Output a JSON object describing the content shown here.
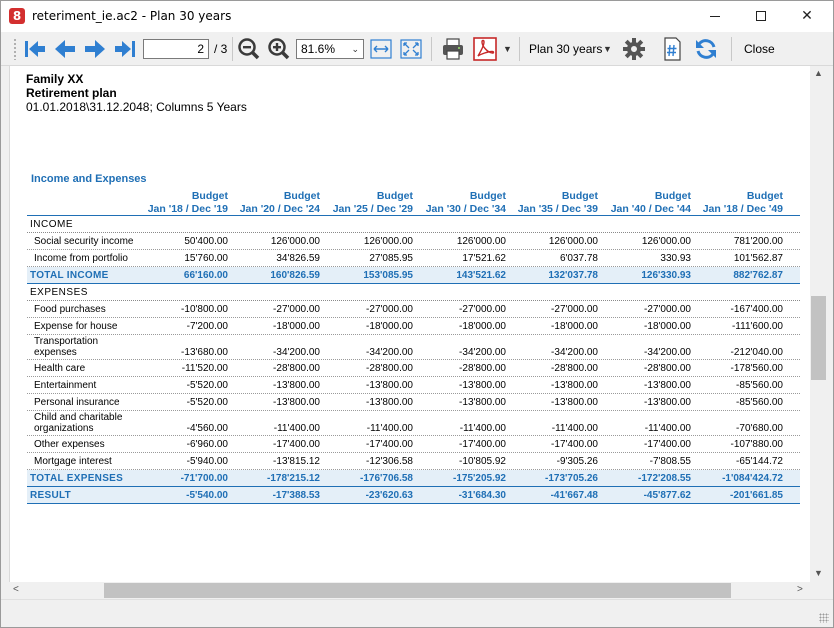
{
  "window": {
    "title": "reteriment_ie.ac2 - Plan 30 years"
  },
  "toolbar": {
    "page_value": "2",
    "page_total": "/ 3",
    "zoom": "81.6%",
    "plan": "Plan 30 years",
    "close_label": "Close"
  },
  "doc": {
    "line1": "Family XX",
    "line2": "Retirement plan",
    "line3": "01.01.2018\\31.12.2048; Columns 5 Years",
    "section": "Income and Expenses"
  },
  "columns": [
    {
      "top": "Budget",
      "bottom": "Jan '18 / Dec '19"
    },
    {
      "top": "Budget",
      "bottom": "Jan '20 / Dec '24"
    },
    {
      "top": "Budget",
      "bottom": "Jan '25 / Dec '29"
    },
    {
      "top": "Budget",
      "bottom": "Jan '30 / Dec '34"
    },
    {
      "top": "Budget",
      "bottom": "Jan '35 / Dec '39"
    },
    {
      "top": "Budget",
      "bottom": "Jan '40 / Dec '44"
    },
    {
      "top": "Budget",
      "bottom": "Jan '18 / Dec '49"
    }
  ],
  "rows": [
    {
      "kind": "sect",
      "label": "INCOME",
      "values": []
    },
    {
      "kind": "item",
      "label": "Social security income",
      "values": [
        "50'400.00",
        "126'000.00",
        "126'000.00",
        "126'000.00",
        "126'000.00",
        "126'000.00",
        "781'200.00"
      ]
    },
    {
      "kind": "item",
      "label": "Income from portfolio",
      "values": [
        "15'760.00",
        "34'826.59",
        "27'085.95",
        "17'521.62",
        "6'037.78",
        "330.93",
        "101'562.87"
      ]
    },
    {
      "kind": "total",
      "label": "TOTAL INCOME",
      "values": [
        "66'160.00",
        "160'826.59",
        "153'085.95",
        "143'521.62",
        "132'037.78",
        "126'330.93",
        "882'762.87"
      ]
    },
    {
      "kind": "sect",
      "label": "EXPENSES",
      "values": []
    },
    {
      "kind": "item",
      "label": "Food purchases",
      "values": [
        "-10'800.00",
        "-27'000.00",
        "-27'000.00",
        "-27'000.00",
        "-27'000.00",
        "-27'000.00",
        "-167'400.00"
      ]
    },
    {
      "kind": "item",
      "label": "Expense for house",
      "values": [
        "-7'200.00",
        "-18'000.00",
        "-18'000.00",
        "-18'000.00",
        "-18'000.00",
        "-18'000.00",
        "-111'600.00"
      ]
    },
    {
      "kind": "item2",
      "label": "Transportation",
      "label2": "expenses",
      "values": [
        "-13'680.00",
        "-34'200.00",
        "-34'200.00",
        "-34'200.00",
        "-34'200.00",
        "-34'200.00",
        "-212'040.00"
      ]
    },
    {
      "kind": "item",
      "label": "Health care",
      "values": [
        "-11'520.00",
        "-28'800.00",
        "-28'800.00",
        "-28'800.00",
        "-28'800.00",
        "-28'800.00",
        "-178'560.00"
      ]
    },
    {
      "kind": "item",
      "label": "Entertainment",
      "values": [
        "-5'520.00",
        "-13'800.00",
        "-13'800.00",
        "-13'800.00",
        "-13'800.00",
        "-13'800.00",
        "-85'560.00"
      ]
    },
    {
      "kind": "item",
      "label": "Personal insurance",
      "values": [
        "-5'520.00",
        "-13'800.00",
        "-13'800.00",
        "-13'800.00",
        "-13'800.00",
        "-13'800.00",
        "-85'560.00"
      ]
    },
    {
      "kind": "item2",
      "label": "Child and charitable",
      "label2": "organizations",
      "values": [
        "-4'560.00",
        "-11'400.00",
        "-11'400.00",
        "-11'400.00",
        "-11'400.00",
        "-11'400.00",
        "-70'680.00"
      ]
    },
    {
      "kind": "item",
      "label": "Other expenses",
      "values": [
        "-6'960.00",
        "-17'400.00",
        "-17'400.00",
        "-17'400.00",
        "-17'400.00",
        "-17'400.00",
        "-107'880.00"
      ]
    },
    {
      "kind": "item",
      "label": "Mortgage interest",
      "values": [
        "-5'940.00",
        "-13'815.12",
        "-12'306.58",
        "-10'805.92",
        "-9'305.26",
        "-7'808.55",
        "-65'144.72"
      ]
    },
    {
      "kind": "total",
      "label": "TOTAL EXPENSES",
      "values": [
        "-71'700.00",
        "-178'215.12",
        "-176'706.58",
        "-175'205.92",
        "-173'705.26",
        "-172'208.55",
        "-1'084'424.72"
      ]
    },
    {
      "kind": "total",
      "label": "RESULT",
      "values": [
        "-5'540.00",
        "-17'388.53",
        "-23'620.63",
        "-31'684.30",
        "-41'667.48",
        "-45'877.62",
        "-201'661.85"
      ]
    }
  ]
}
